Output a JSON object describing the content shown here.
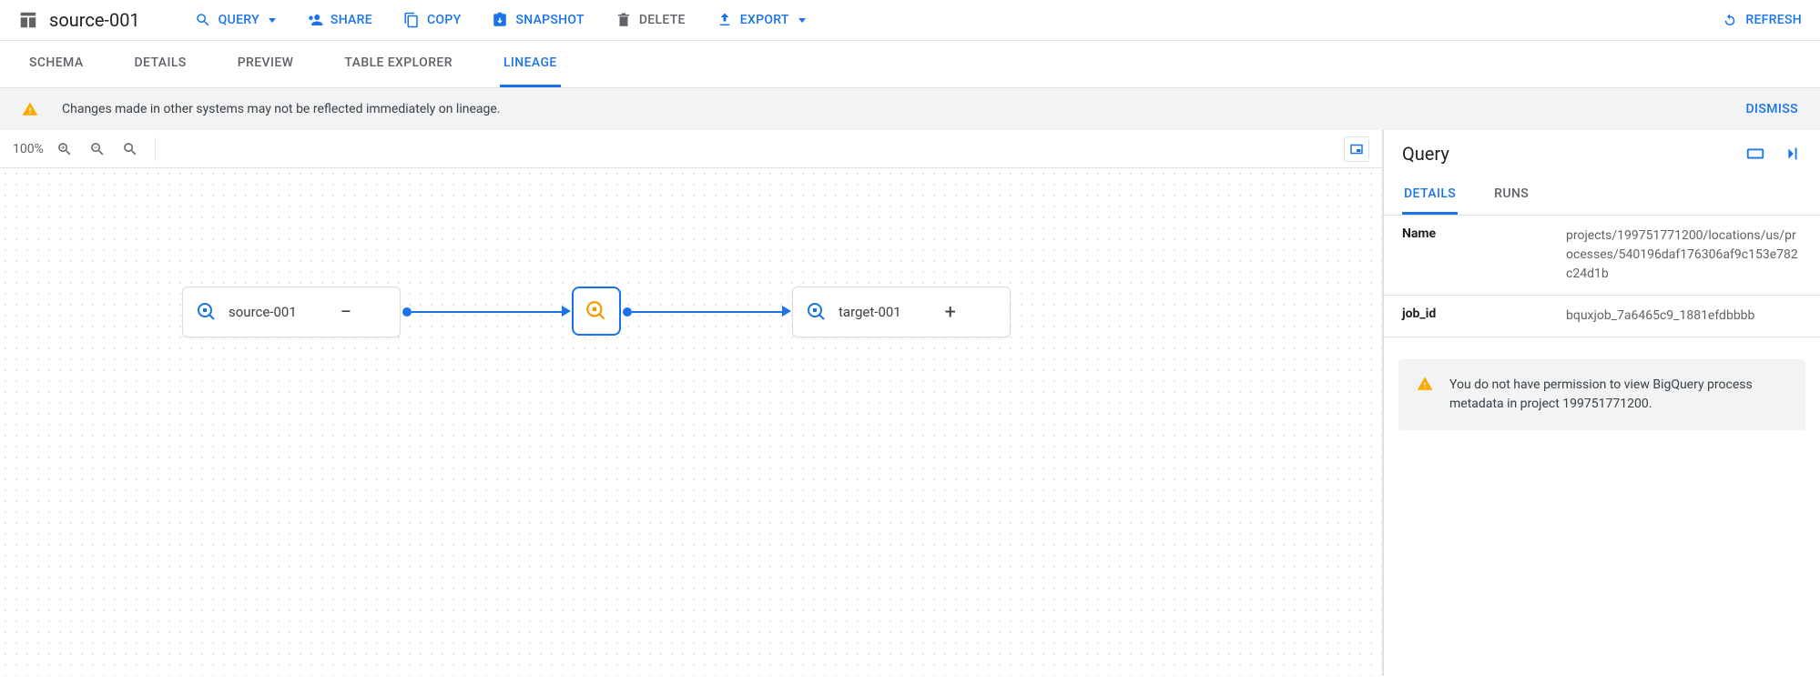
{
  "header": {
    "title": "source-001",
    "actions": {
      "query": "QUERY",
      "share": "SHARE",
      "copy": "COPY",
      "snapshot": "SNAPSHOT",
      "delete": "DELETE",
      "export": "EXPORT",
      "refresh": "REFRESH"
    }
  },
  "tabs": {
    "schema": "SCHEMA",
    "details": "DETAILS",
    "preview": "PREVIEW",
    "table_explorer": "TABLE EXPLORER",
    "lineage": "LINEAGE"
  },
  "banner": {
    "message": "Changes made in other systems may not be reflected immediately on lineage.",
    "dismiss": "DISMISS"
  },
  "canvas": {
    "zoom": "100%",
    "source_node": "source-001",
    "target_node": "target-001"
  },
  "sidepanel": {
    "title": "Query",
    "tabs": {
      "details": "DETAILS",
      "runs": "RUNS"
    },
    "rows": {
      "name_key": "Name",
      "name_val": "projects/199751771200/locations/us/processes/540196daf176306af9c153e782c24d1b",
      "jobid_key": "job_id",
      "jobid_val": "bquxjob_7a6465c9_1881efdbbbb"
    },
    "warning": "You do not have permission to view BigQuery process metadata in project 199751771200."
  }
}
